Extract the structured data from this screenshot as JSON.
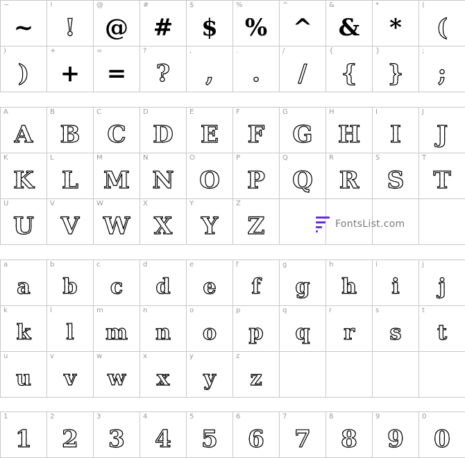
{
  "sections": [
    {
      "id": "symbols",
      "cells": [
        {
          "label": "~",
          "glyph": "~"
        },
        {
          "label": "!",
          "glyph": "!"
        },
        {
          "label": "@",
          "glyph": "@"
        },
        {
          "label": "#",
          "glyph": "#"
        },
        {
          "label": "$",
          "glyph": "$"
        },
        {
          "label": "%",
          "glyph": "%"
        },
        {
          "label": "^",
          "glyph": "^"
        },
        {
          "label": "&",
          "glyph": "&"
        },
        {
          "label": "*",
          "glyph": "*"
        },
        {
          "label": "(",
          "glyph": "("
        },
        {
          "label": ")",
          "glyph": ")"
        },
        {
          "label": "+",
          "glyph": "+"
        },
        {
          "label": "=",
          "glyph": "="
        },
        {
          "label": "?",
          "glyph": "?"
        },
        {
          "label": ",",
          "glyph": ","
        },
        {
          "label": ".",
          "glyph": "."
        },
        {
          "label": "/",
          "glyph": "/"
        },
        {
          "label": "{",
          "glyph": "{"
        },
        {
          "label": "}",
          "glyph": "}"
        },
        {
          "label": ";",
          "glyph": ";"
        }
      ]
    },
    {
      "id": "uppercase",
      "cells": [
        {
          "label": "A",
          "glyph": "A"
        },
        {
          "label": "B",
          "glyph": "B"
        },
        {
          "label": "C",
          "glyph": "C"
        },
        {
          "label": "D",
          "glyph": "D"
        },
        {
          "label": "E",
          "glyph": "E"
        },
        {
          "label": "F",
          "glyph": "F"
        },
        {
          "label": "G",
          "glyph": "G"
        },
        {
          "label": "H",
          "glyph": "H"
        },
        {
          "label": "I",
          "glyph": "I"
        },
        {
          "label": "J",
          "glyph": "J"
        },
        {
          "label": "K",
          "glyph": "K"
        },
        {
          "label": "L",
          "glyph": "L"
        },
        {
          "label": "M",
          "glyph": "M"
        },
        {
          "label": "N",
          "glyph": "N"
        },
        {
          "label": "O",
          "glyph": "O"
        },
        {
          "label": "P",
          "glyph": "P"
        },
        {
          "label": "Q",
          "glyph": "Q"
        },
        {
          "label": "R",
          "glyph": "R"
        },
        {
          "label": "S",
          "glyph": "S"
        },
        {
          "label": "T",
          "glyph": "T"
        },
        {
          "label": "U",
          "glyph": "U"
        },
        {
          "label": "V",
          "glyph": "V"
        },
        {
          "label": "W",
          "glyph": "W"
        },
        {
          "label": "X",
          "glyph": "X"
        },
        {
          "label": "Y",
          "glyph": "Y"
        },
        {
          "label": "Z",
          "glyph": "Z"
        },
        {
          "label": "",
          "glyph": ""
        },
        {
          "label": "",
          "glyph": ""
        },
        {
          "label": "",
          "glyph": ""
        },
        {
          "label": "",
          "glyph": ""
        }
      ]
    },
    {
      "id": "lowercase",
      "cells": [
        {
          "label": "a",
          "glyph": "a"
        },
        {
          "label": "b",
          "glyph": "b"
        },
        {
          "label": "c",
          "glyph": "c"
        },
        {
          "label": "d",
          "glyph": "d"
        },
        {
          "label": "e",
          "glyph": "e"
        },
        {
          "label": "f",
          "glyph": "f"
        },
        {
          "label": "g",
          "glyph": "g"
        },
        {
          "label": "h",
          "glyph": "h"
        },
        {
          "label": "i",
          "glyph": "i"
        },
        {
          "label": "j",
          "glyph": "j"
        },
        {
          "label": "k",
          "glyph": "k"
        },
        {
          "label": "l",
          "glyph": "l"
        },
        {
          "label": "m",
          "glyph": "m"
        },
        {
          "label": "n",
          "glyph": "n"
        },
        {
          "label": "o",
          "glyph": "o"
        },
        {
          "label": "p",
          "glyph": "p"
        },
        {
          "label": "q",
          "glyph": "q"
        },
        {
          "label": "r",
          "glyph": "r"
        },
        {
          "label": "s",
          "glyph": "s"
        },
        {
          "label": "t",
          "glyph": "t"
        },
        {
          "label": "u",
          "glyph": "u"
        },
        {
          "label": "v",
          "glyph": "v"
        },
        {
          "label": "w",
          "glyph": "w"
        },
        {
          "label": "x",
          "glyph": "x"
        },
        {
          "label": "y",
          "glyph": "y"
        },
        {
          "label": "z",
          "glyph": "z"
        },
        {
          "label": "",
          "glyph": ""
        },
        {
          "label": "",
          "glyph": ""
        },
        {
          "label": "",
          "glyph": ""
        },
        {
          "label": "",
          "glyph": ""
        }
      ]
    },
    {
      "id": "digits",
      "cells": [
        {
          "label": "1",
          "glyph": "1"
        },
        {
          "label": "2",
          "glyph": "2"
        },
        {
          "label": "3",
          "glyph": "3"
        },
        {
          "label": "4",
          "glyph": "4"
        },
        {
          "label": "5",
          "glyph": "5"
        },
        {
          "label": "6",
          "glyph": "6"
        },
        {
          "label": "7",
          "glyph": "7"
        },
        {
          "label": "8",
          "glyph": "8"
        },
        {
          "label": "9",
          "glyph": "9"
        },
        {
          "label": "0",
          "glyph": "0"
        }
      ]
    }
  ],
  "watermark": {
    "text": "FontsList.com",
    "accent_color": "#6a2bd9",
    "icon": "fontslist-logo-icon"
  }
}
